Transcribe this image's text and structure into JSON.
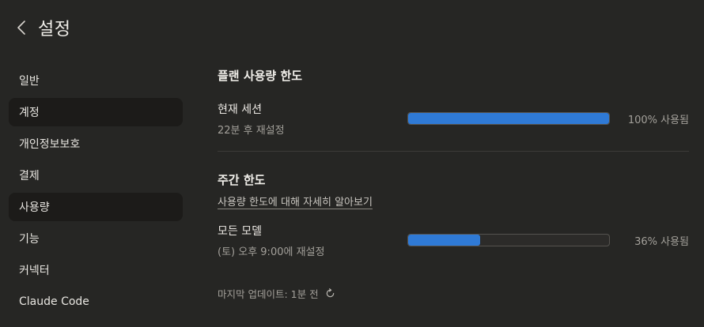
{
  "header": {
    "title": "설정",
    "back_icon": "chevron-left-icon"
  },
  "sidebar": {
    "items": [
      {
        "label": "일반",
        "active": false
      },
      {
        "label": "계정",
        "active": true
      },
      {
        "label": "개인정보보호",
        "active": false
      },
      {
        "label": "결제",
        "active": false
      },
      {
        "label": "사용량",
        "active": true
      },
      {
        "label": "기능",
        "active": false
      },
      {
        "label": "커넥터",
        "active": false
      },
      {
        "label": "Claude Code",
        "active": false
      }
    ]
  },
  "plan_limits": {
    "title": "플랜 사용량 한도",
    "current_session": {
      "title": "현재 세션",
      "reset": "22분 후 재설정",
      "usage_percent": 100,
      "usage_label": "100% 사용됨"
    }
  },
  "weekly_limits": {
    "title": "주간 한도",
    "learn_more": "사용량 한도에 대해 자세히 알아보기",
    "all_models": {
      "title": "모든 모델",
      "reset": "(토) 오후 9:00에 재설정",
      "usage_percent": 36,
      "usage_label": "36% 사용됨"
    }
  },
  "footer": {
    "last_updated": "마지막 업데이트: 1분 전",
    "refresh_icon": "refresh-icon"
  },
  "colors": {
    "accent": "#2f7ad6",
    "background": "#262624",
    "active_item": "#1c1b19"
  }
}
